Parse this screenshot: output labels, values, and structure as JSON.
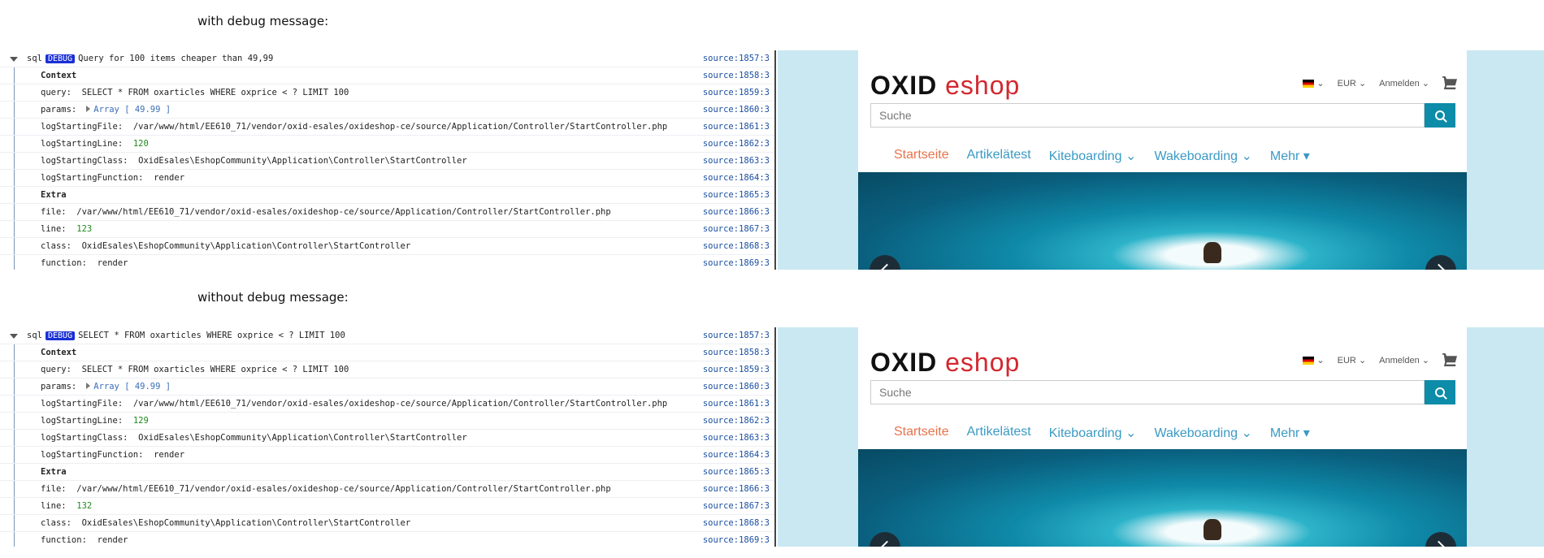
{
  "captions": {
    "with": "with debug message:",
    "without": "without debug message:"
  },
  "debug_badge": "DEBUG",
  "panels": [
    {
      "rows": [
        {
          "type": "head",
          "label": "sql",
          "msg": "Query for 100 items cheaper than 49,99",
          "src": "source:1857:3"
        },
        {
          "type": "bold",
          "text": "Context",
          "src": "source:1858:3"
        },
        {
          "type": "kv",
          "key": "query:",
          "val": "SELECT * FROM oxarticles WHERE oxprice < ? LIMIT 100",
          "src": "source:1859:3"
        },
        {
          "type": "arr",
          "key": "params:",
          "val": "Array [ 49.99 ]",
          "src": "source:1860:3"
        },
        {
          "type": "kv",
          "key": "logStartingFile:",
          "val": "/var/www/html/EE610_71/vendor/oxid-esales/oxideshop-ce/source/Application/Controller/StartController.php",
          "src": "source:1861:3"
        },
        {
          "type": "num",
          "key": "logStartingLine:",
          "val": "120",
          "src": "source:1862:3"
        },
        {
          "type": "kv",
          "key": "logStartingClass:",
          "val": "OxidEsales\\EshopCommunity\\Application\\Controller\\StartController",
          "src": "source:1863:3"
        },
        {
          "type": "kv",
          "key": "logStartingFunction:",
          "val": "render",
          "src": "source:1864:3"
        },
        {
          "type": "bold",
          "text": "Extra",
          "src": "source:1865:3"
        },
        {
          "type": "kv",
          "key": "file:",
          "val": "/var/www/html/EE610_71/vendor/oxid-esales/oxideshop-ce/source/Application/Controller/StartController.php",
          "src": "source:1866:3"
        },
        {
          "type": "num",
          "key": "line:",
          "val": "123",
          "src": "source:1867:3"
        },
        {
          "type": "kv",
          "key": "class:",
          "val": "OxidEsales\\EshopCommunity\\Application\\Controller\\StartController",
          "src": "source:1868:3"
        },
        {
          "type": "kv",
          "key": "function:",
          "val": "render",
          "src": "source:1869:3"
        }
      ]
    },
    {
      "rows": [
        {
          "type": "head",
          "label": "sql",
          "msg": "SELECT * FROM oxarticles WHERE oxprice < ? LIMIT 100",
          "src": "source:1857:3"
        },
        {
          "type": "bold",
          "text": "Context",
          "src": "source:1858:3"
        },
        {
          "type": "kv",
          "key": "query:",
          "val": "SELECT * FROM oxarticles WHERE oxprice < ? LIMIT 100",
          "src": "source:1859:3"
        },
        {
          "type": "arr",
          "key": "params:",
          "val": "Array [ 49.99 ]",
          "src": "source:1860:3"
        },
        {
          "type": "kv",
          "key": "logStartingFile:",
          "val": "/var/www/html/EE610_71/vendor/oxid-esales/oxideshop-ce/source/Application/Controller/StartController.php",
          "src": "source:1861:3"
        },
        {
          "type": "num",
          "key": "logStartingLine:",
          "val": "129",
          "src": "source:1862:3"
        },
        {
          "type": "kv",
          "key": "logStartingClass:",
          "val": "OxidEsales\\EshopCommunity\\Application\\Controller\\StartController",
          "src": "source:1863:3"
        },
        {
          "type": "kv",
          "key": "logStartingFunction:",
          "val": "render",
          "src": "source:1864:3"
        },
        {
          "type": "bold",
          "text": "Extra",
          "src": "source:1865:3"
        },
        {
          "type": "kv",
          "key": "file:",
          "val": "/var/www/html/EE610_71/vendor/oxid-esales/oxideshop-ce/source/Application/Controller/StartController.php",
          "src": "source:1866:3"
        },
        {
          "type": "num",
          "key": "line:",
          "val": "132",
          "src": "source:1867:3"
        },
        {
          "type": "kv",
          "key": "class:",
          "val": "OxidEsales\\EshopCommunity\\Application\\Controller\\StartController",
          "src": "source:1868:3"
        },
        {
          "type": "kv",
          "key": "function:",
          "val": "render",
          "src": "source:1869:3"
        }
      ]
    }
  ],
  "shop": {
    "logo_part1": "OXID",
    "logo_part2": "eshop",
    "currency": "EUR",
    "login": "Anmelden",
    "search_placeholder": "Suche",
    "menu": [
      "Startseite",
      "Artikelätest",
      "Kiteboarding",
      "Wakeboarding",
      "Mehr"
    ]
  },
  "colors": {
    "debug_badge": "#1a2fd6",
    "menu_active": "#e8724a",
    "menu": "#3b9ac4",
    "search_button": "#0c8ca8",
    "page_bg": "#c9e8f2"
  }
}
